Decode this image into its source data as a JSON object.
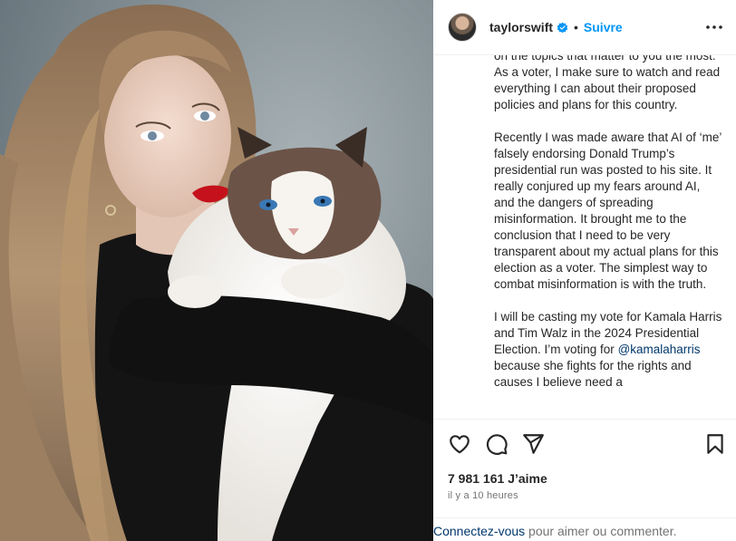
{
  "post": {
    "username": "taylorswift",
    "separator": "•",
    "follow_label": "Suivre",
    "caption_before_mention": "on the topics that matter to you the most. As a voter, I make sure to watch and read everything I can about their proposed policies and plans for this country.\n\nRecently I was made aware that AI of ‘me’ falsely endorsing Donald Trump’s presidential run was posted to his site. It really conjured up my fears around AI, and the dangers of spreading misinformation. It brought me to the conclusion that I need to be very transparent about my actual plans for this election as a voter. The simplest way to combat misinformation is with the truth.\n\nI will be casting my vote for Kamala Harris and Tim Walz in the 2024 Presidential Election. I’m voting for ",
    "mention": "@kamalaharris",
    "caption_after_mention": " because she fights for the rights and causes I believe need a",
    "likes_count": "7 981 161",
    "likes_label": "J’aime",
    "time_ago": "il y a 10 heures",
    "login_link": "Connectez-vous",
    "login_text": " pour aimer ou commenter."
  },
  "icons": {
    "verified": "verified-badge-icon",
    "more": "more-options-icon",
    "like": "heart-icon",
    "comment": "comment-bubble-icon",
    "share": "paper-plane-icon",
    "save": "bookmark-icon"
  },
  "colors": {
    "link_blue": "#0095f6",
    "mention_blue": "#00376b",
    "muted": "#737373",
    "verified": "#0095f6"
  }
}
